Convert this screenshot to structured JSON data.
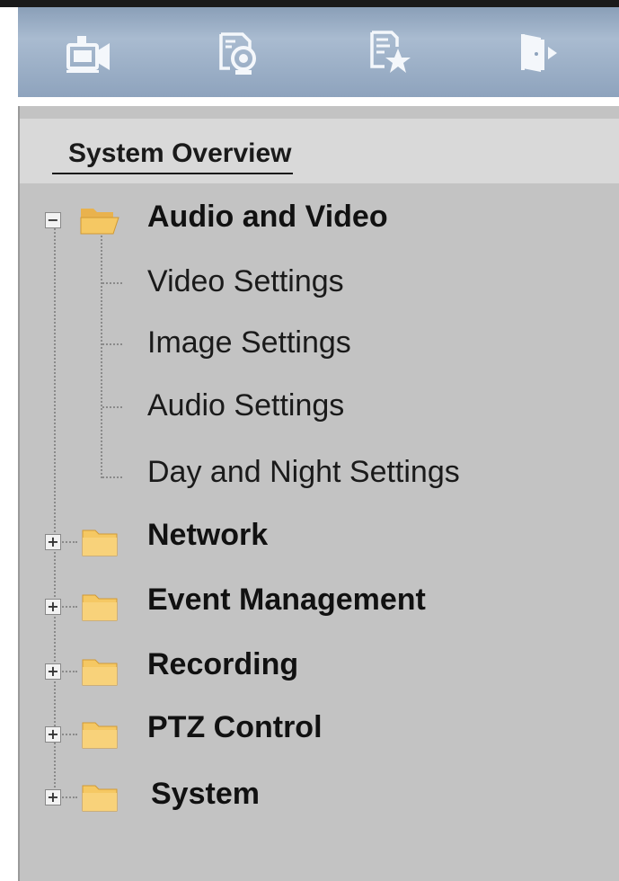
{
  "toolbar": {
    "icons": [
      {
        "name": "live-view-camera-icon"
      },
      {
        "name": "playback-icon"
      },
      {
        "name": "favorites-log-icon"
      },
      {
        "name": "logout-icon"
      }
    ]
  },
  "sidebar": {
    "overview": "System Overview",
    "categories": [
      {
        "label": "Audio and Video",
        "expanded": true,
        "children": [
          "Video Settings",
          "Image Settings",
          "Audio Settings",
          "Day and Night Settings"
        ]
      },
      {
        "label": "Network",
        "expanded": false
      },
      {
        "label": "Event Management",
        "expanded": false
      },
      {
        "label": "Recording",
        "expanded": false
      },
      {
        "label": "PTZ Control",
        "expanded": false
      },
      {
        "label": "System",
        "expanded": false
      }
    ]
  },
  "colors": {
    "toolbar_bg": "#9aaec6",
    "panel_bg": "#c3c3c3",
    "overview_bg": "#d9d9d9",
    "folder_yellow": "#f5c863"
  }
}
